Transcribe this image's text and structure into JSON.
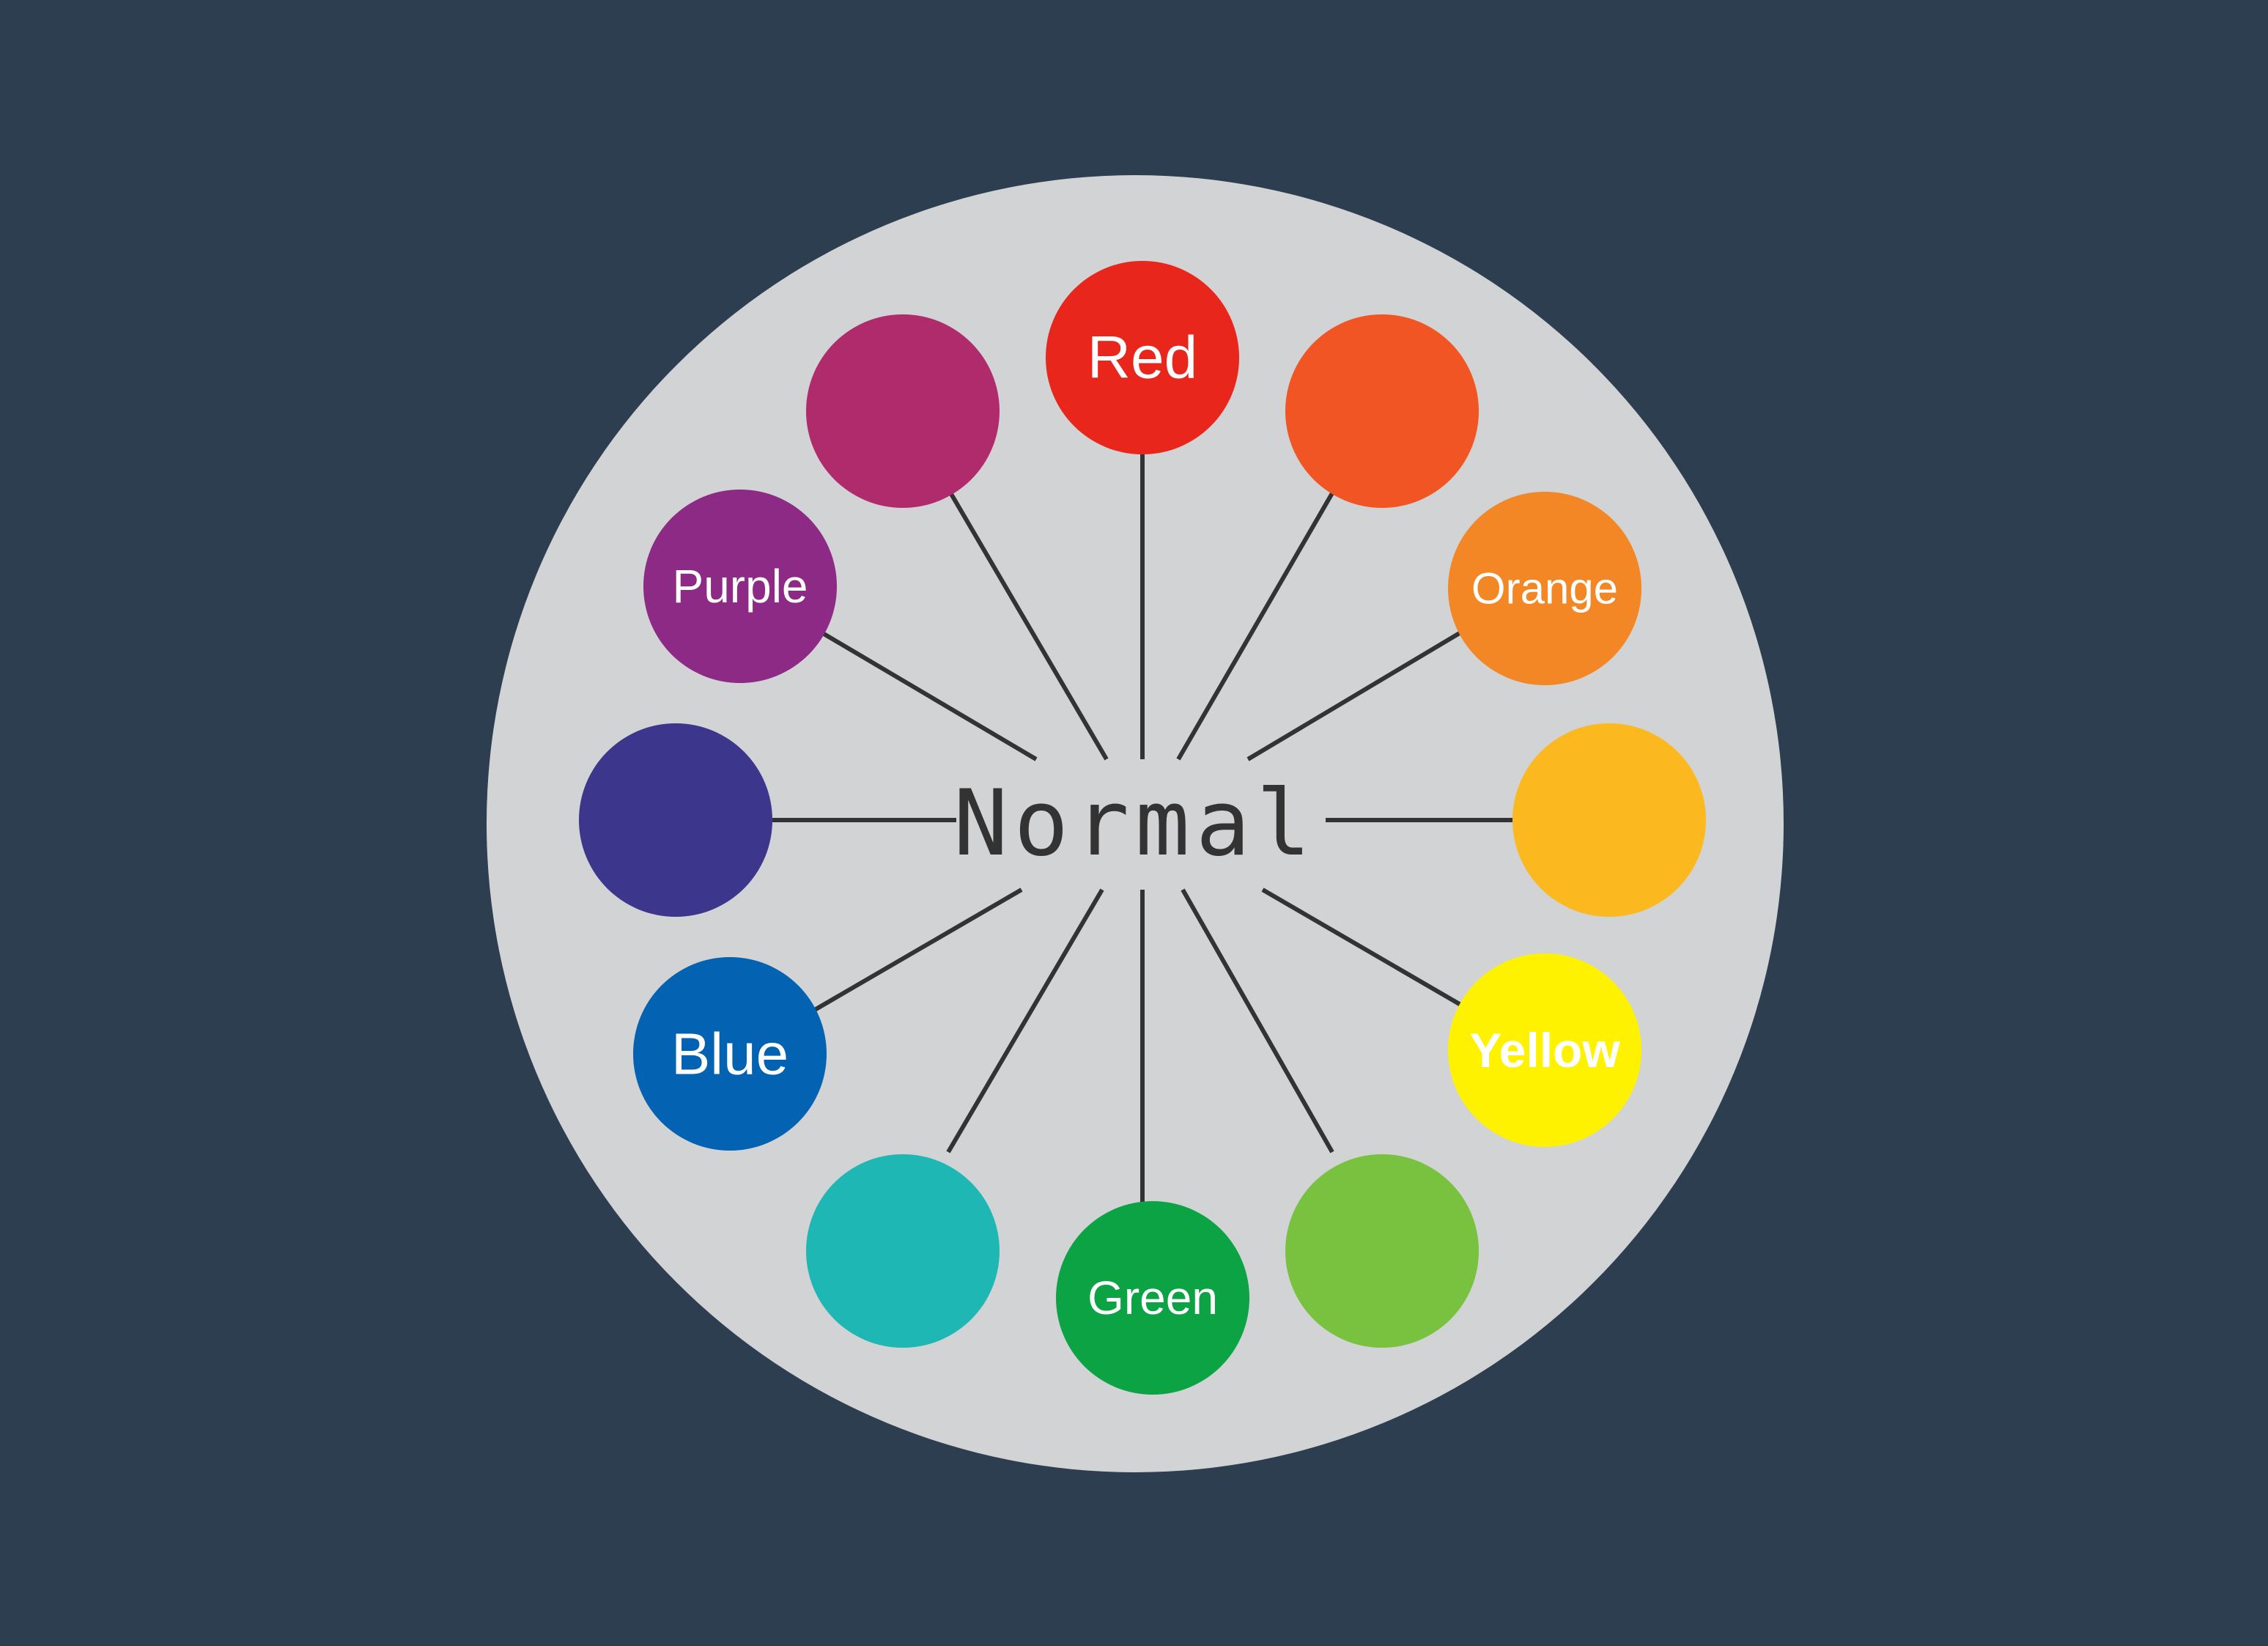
{
  "diagram": {
    "center_label": "Normal",
    "colors": {
      "background": "#2d3e50",
      "plate": "#d2d3d5",
      "spoke": "#333333",
      "center_text": "#333333",
      "label_text": "#ffffff"
    },
    "swatches": [
      {
        "name": "red",
        "label": "Red",
        "color": "#e8261c"
      },
      {
        "name": "red-orange",
        "label": "",
        "color": "#f05523"
      },
      {
        "name": "orange",
        "label": "Orange",
        "color": "#f38725"
      },
      {
        "name": "yellow-orange",
        "label": "",
        "color": "#fbb81f"
      },
      {
        "name": "yellow",
        "label": "Yellow",
        "color": "#fff200"
      },
      {
        "name": "yellow-green",
        "label": "",
        "color": "#78c240"
      },
      {
        "name": "green",
        "label": "Green",
        "color": "#0ba343"
      },
      {
        "name": "blue-green",
        "label": "",
        "color": "#1fb7b3"
      },
      {
        "name": "blue",
        "label": "Blue",
        "color": "#0363b2"
      },
      {
        "name": "blue-violet",
        "label": "",
        "color": "#3c368c"
      },
      {
        "name": "purple",
        "label": "Purple",
        "color": "#8c2a85"
      },
      {
        "name": "red-violet",
        "label": "",
        "color": "#b02b6c"
      }
    ]
  }
}
